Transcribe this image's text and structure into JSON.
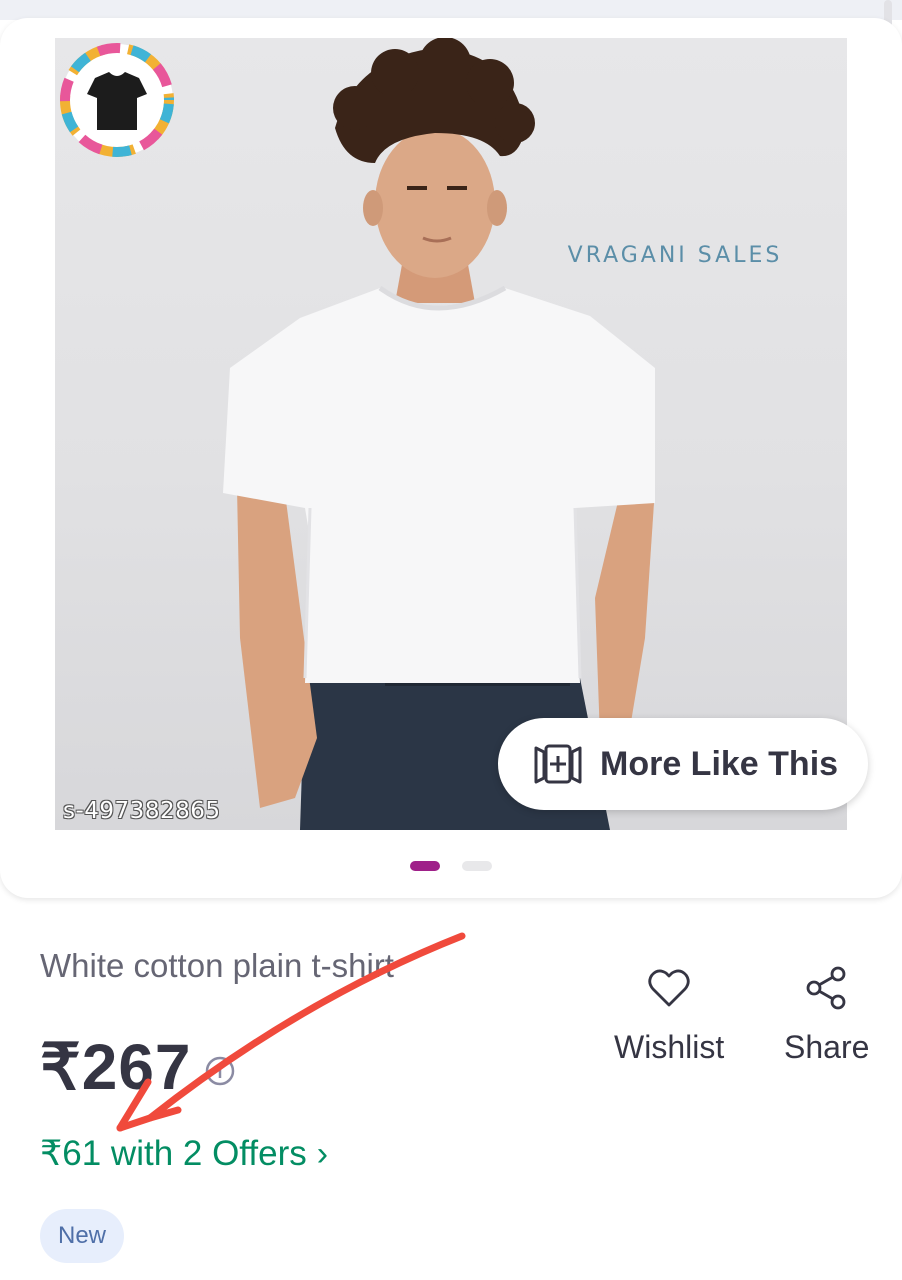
{
  "product": {
    "image": {
      "sku_watermark": "s-497382865",
      "brand_text": "VRAGANI SALES",
      "more_like_label": "More Like This",
      "carousel": {
        "active_index": 0,
        "count": 2
      }
    },
    "title": "White cotton plain t-shirt",
    "price": "₹267",
    "offers_text": "₹61 with 2 Offers",
    "badge": "New"
  },
  "actions": {
    "wishlist_label": "Wishlist",
    "share_label": "Share"
  },
  "colors": {
    "accent": "#9f2089",
    "offer_green": "#038d63",
    "annotation_arrow": "#f04a3c"
  }
}
